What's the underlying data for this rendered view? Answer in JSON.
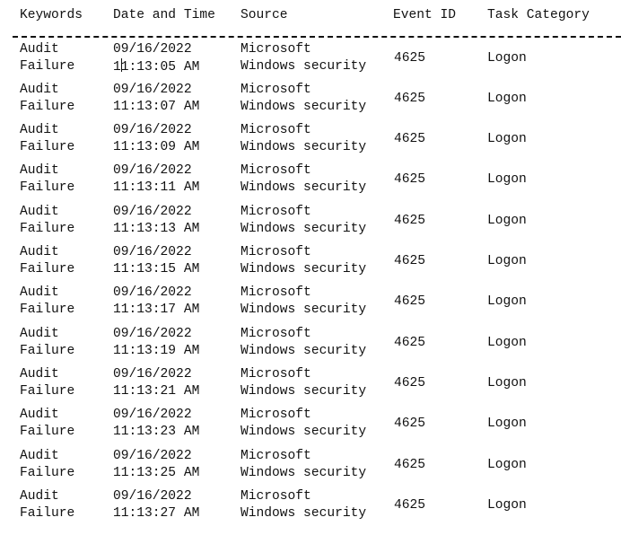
{
  "columns": [
    "Keywords",
    "Date and Time",
    "Source",
    "Event ID",
    "Task Category"
  ],
  "rows": [
    {
      "kw1": "Audit",
      "kw2": "Failure",
      "date": "09/16/2022",
      "time": "11:13:05 AM",
      "src1": "Microsoft",
      "src2": "Windows security",
      "id": "4625",
      "cat": "Logon"
    },
    {
      "kw1": "Audit",
      "kw2": "Failure",
      "date": "09/16/2022",
      "time": "11:13:07 AM",
      "src1": "Microsoft",
      "src2": "Windows security",
      "id": "4625",
      "cat": "Logon"
    },
    {
      "kw1": "Audit",
      "kw2": "Failure",
      "date": "09/16/2022",
      "time": "11:13:09 AM",
      "src1": "Microsoft",
      "src2": "Windows security",
      "id": "4625",
      "cat": "Logon"
    },
    {
      "kw1": "Audit",
      "kw2": "Failure",
      "date": "09/16/2022",
      "time": "11:13:11 AM",
      "src1": "Microsoft",
      "src2": "Windows security",
      "id": "4625",
      "cat": "Logon"
    },
    {
      "kw1": "Audit",
      "kw2": "Failure",
      "date": "09/16/2022",
      "time": "11:13:13 AM",
      "src1": "Microsoft",
      "src2": "Windows security",
      "id": "4625",
      "cat": "Logon"
    },
    {
      "kw1": "Audit",
      "kw2": "Failure",
      "date": "09/16/2022",
      "time": "11:13:15 AM",
      "src1": "Microsoft",
      "src2": "Windows security",
      "id": "4625",
      "cat": "Logon"
    },
    {
      "kw1": "Audit",
      "kw2": "Failure",
      "date": "09/16/2022",
      "time": "11:13:17 AM",
      "src1": "Microsoft",
      "src2": "Windows security",
      "id": "4625",
      "cat": "Logon"
    },
    {
      "kw1": "Audit",
      "kw2": "Failure",
      "date": "09/16/2022",
      "time": "11:13:19 AM",
      "src1": "Microsoft",
      "src2": "Windows security",
      "id": "4625",
      "cat": "Logon"
    },
    {
      "kw1": "Audit",
      "kw2": "Failure",
      "date": "09/16/2022",
      "time": "11:13:21 AM",
      "src1": "Microsoft",
      "src2": "Windows security",
      "id": "4625",
      "cat": "Logon"
    },
    {
      "kw1": "Audit",
      "kw2": "Failure",
      "date": "09/16/2022",
      "time": "11:13:23 AM",
      "src1": "Microsoft",
      "src2": "Windows security",
      "id": "4625",
      "cat": "Logon"
    },
    {
      "kw1": "Audit",
      "kw2": "Failure",
      "date": "09/16/2022",
      "time": "11:13:25 AM",
      "src1": "Microsoft",
      "src2": "Windows security",
      "id": "4625",
      "cat": "Logon"
    },
    {
      "kw1": "Audit",
      "kw2": "Failure",
      "date": "09/16/2022",
      "time": "11:13:27 AM",
      "src1": "Microsoft",
      "src2": "Windows security",
      "id": "4625",
      "cat": "Logon"
    }
  ]
}
